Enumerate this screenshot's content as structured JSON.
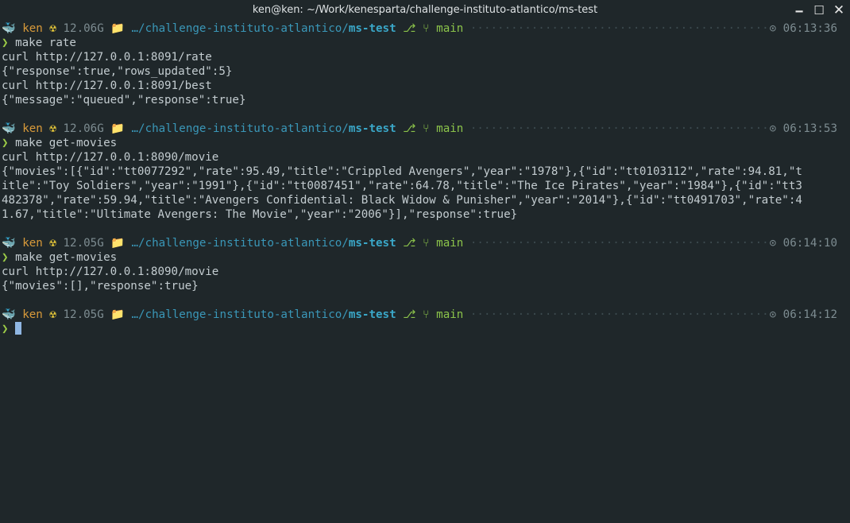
{
  "window": {
    "title": "ken@ken: ~/Work/kenesparta/challenge-instituto-atlantico/ms-test",
    "minimize_glyph": "🗕",
    "maximize_glyph": "☐",
    "close_glyph": "✕"
  },
  "prompt_common": {
    "whale": "🐳",
    "user": "ken",
    "radioactive": "☢",
    "folder": "📁",
    "path_prefix": "…/challenge-instituto-atlantico/",
    "path_dir": "ms-test",
    "git_icon": "⎇",
    "branch_icon": "⑂",
    "branch": "main",
    "clock_icon": "⊙",
    "chevron": "❯"
  },
  "blocks": [
    {
      "mem": "12.06G",
      "time": "06:13:36",
      "command": "make rate",
      "output": [
        "curl http://127.0.0.1:8091/rate",
        "{\"response\":true,\"rows_updated\":5}",
        "curl http://127.0.0.1:8091/best",
        "{\"message\":\"queued\",\"response\":true}"
      ]
    },
    {
      "mem": "12.06G",
      "time": "06:13:53",
      "command": "make get-movies",
      "output": [
        "curl http://127.0.0.1:8090/movie",
        "{\"movies\":[{\"id\":\"tt0077292\",\"rate\":95.49,\"title\":\"Crippled Avengers\",\"year\":\"1978\"},{\"id\":\"tt0103112\",\"rate\":94.81,\"t",
        "itle\":\"Toy Soldiers\",\"year\":\"1991\"},{\"id\":\"tt0087451\",\"rate\":64.78,\"title\":\"The Ice Pirates\",\"year\":\"1984\"},{\"id\":\"tt3",
        "482378\",\"rate\":59.94,\"title\":\"Avengers Confidential: Black Widow & Punisher\",\"year\":\"2014\"},{\"id\":\"tt0491703\",\"rate\":4",
        "1.67,\"title\":\"Ultimate Avengers: The Movie\",\"year\":\"2006\"}],\"response\":true}"
      ]
    },
    {
      "mem": "12.05G",
      "time": "06:14:10",
      "command": "make get-movies",
      "output": [
        "curl http://127.0.0.1:8090/movie",
        "{\"movies\":[],\"response\":true}"
      ]
    },
    {
      "mem": "12.05G",
      "time": "06:14:12",
      "command": "",
      "output": []
    }
  ]
}
